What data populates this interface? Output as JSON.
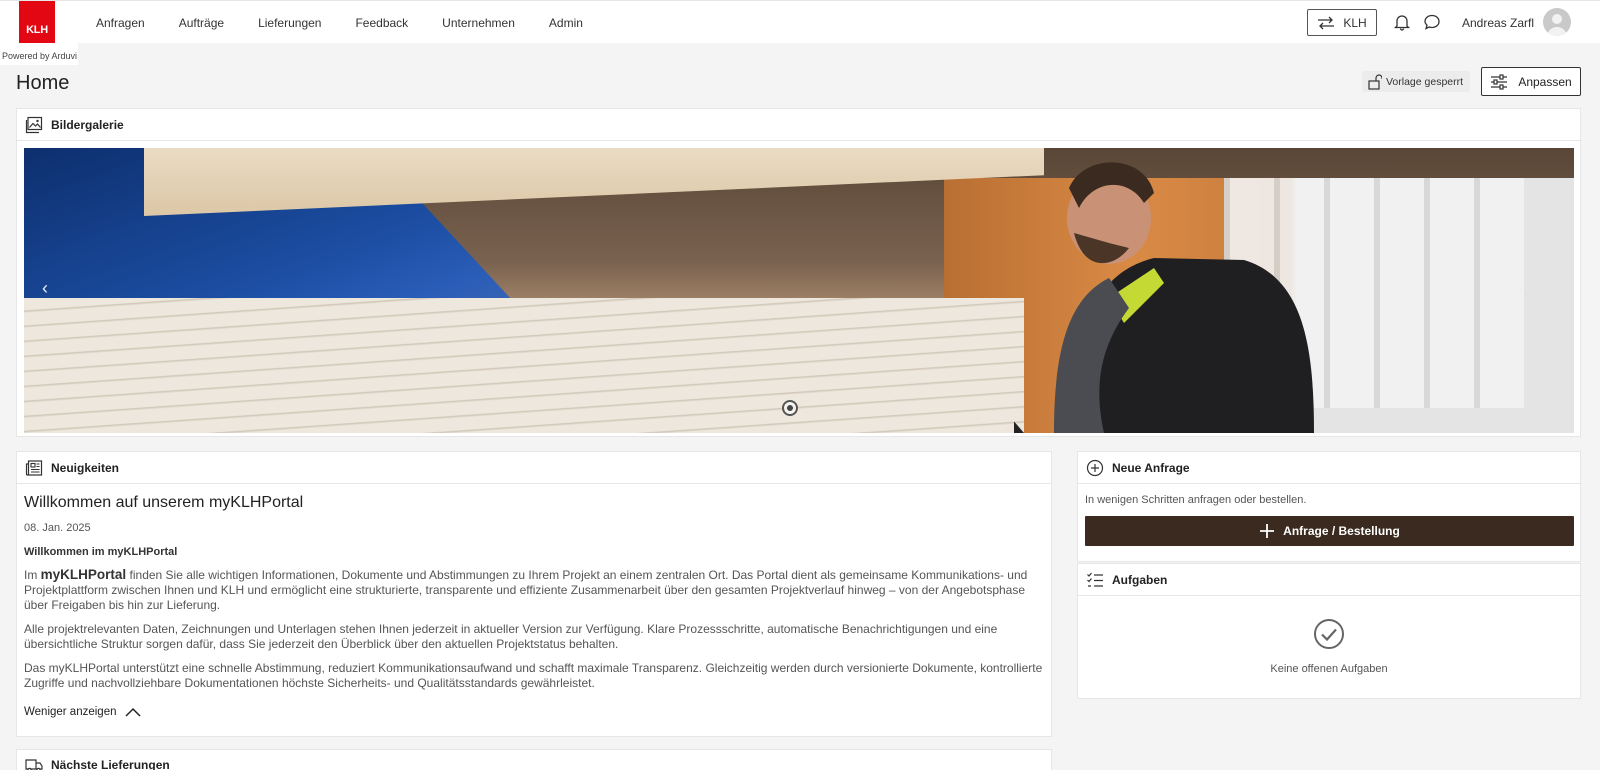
{
  "brand": {
    "logo_text": "KLH",
    "powered_by": "Powered by Arduvi",
    "accent": "#e30613"
  },
  "nav": {
    "items": [
      "Anfragen",
      "Aufträge",
      "Lieferungen",
      "Feedback",
      "Unternehmen",
      "Admin"
    ]
  },
  "topbar": {
    "switch_label": "KLH",
    "switch_icon": "swap-arrows-icon",
    "bell_icon": "bell-icon",
    "chat_icon": "chat-bubble-icon",
    "user_name": "Andreas Zarfl"
  },
  "page": {
    "title": "Home",
    "lock_label": "Vorlage gesperrt",
    "customize_label": "Anpassen"
  },
  "gallery": {
    "title": "Bildergalerie",
    "prev": "‹",
    "next": "›"
  },
  "news": {
    "title": "Neuigkeiten",
    "heading": "Willkommen auf unserem myKLHPortal",
    "date": "08. Jan. 2025",
    "subheading": "Willkommen im myKLHPortal",
    "p1_prefix": "Im ",
    "p1_brand": "myKLHPortal",
    "p1_rest": " finden Sie alle wichtigen Informationen, Dokumente und Abstimmungen zu Ihrem Projekt an einem zentralen Ort. Das Portal dient als gemeinsame Kommunikations- und Projektplattform zwischen Ihnen und KLH und ermöglicht eine strukturierte, transparente und effiziente Zusammenarbeit über den gesamten Projektverlauf hinweg – von der Angebotsphase über Freigaben bis hin zur Lieferung.",
    "p2": "Alle projektrelevanten Daten, Zeichnungen und Unterlagen stehen Ihnen jederzeit in aktueller Version zur Verfügung. Klare Prozessschritte, automatische Benachrichtigungen und eine übersichtliche Struktur sorgen dafür, dass Sie jederzeit den Überblick über den aktuellen Projektstatus behalten.",
    "p3": "Das myKLHPortal unterstützt eine schnelle Abstimmung, reduziert Kommunikationsaufwand und schafft maximale Transparenz. Gleichzeitig werden durch versionierte Dokumente, kontrollierte Zugriffe und nachvollziehbare Dokumentationen höchste Sicherheits- und Qualitätsstandards gewährleistet.",
    "less_label": "Weniger anzeigen"
  },
  "deliveries": {
    "title": "Nächste Lieferungen"
  },
  "new_request": {
    "title": "Neue Anfrage",
    "text": "In wenigen Schritten anfragen oder bestellen.",
    "button": "Anfrage / Bestellung",
    "button_color": "#3a2a1f"
  },
  "tasks": {
    "title": "Aufgaben",
    "empty_text": "Keine offenen Aufgaben"
  }
}
